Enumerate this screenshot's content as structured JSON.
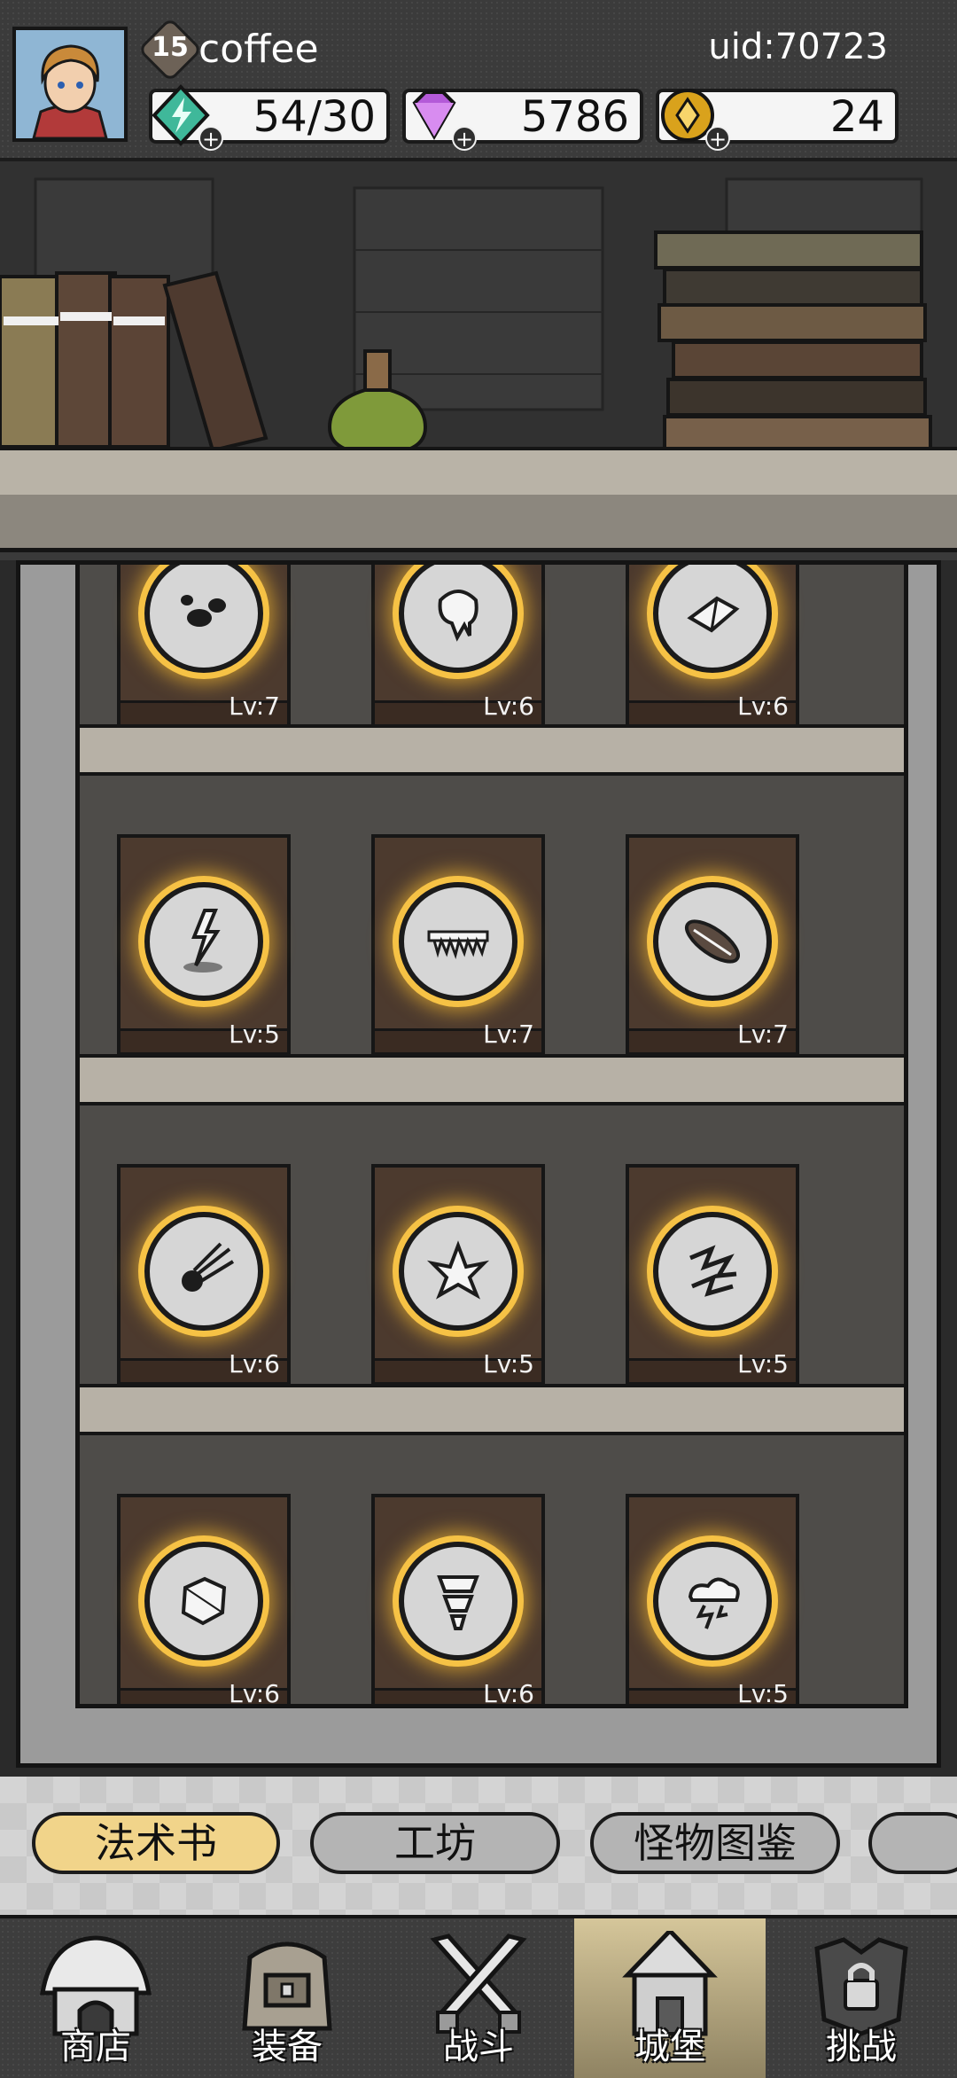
{
  "player": {
    "level": "15",
    "name": "coffee",
    "uid": "uid:70723"
  },
  "resources": [
    {
      "icon": "energy-lightning-gem-icon",
      "value": "54/30",
      "color": "#3fb89a"
    },
    {
      "icon": "purple-diamond-icon",
      "value": "5786",
      "color": "#b45ad8"
    },
    {
      "icon": "gold-coin-icon",
      "value": "24",
      "color": "#d9a21c"
    }
  ],
  "spellbooks": [
    {
      "icon": "dark-splash-icon",
      "level": "Lv:7"
    },
    {
      "icon": "slime-drip-icon",
      "level": "Lv:6"
    },
    {
      "icon": "crystal-shard-icon",
      "level": "Lv:6"
    },
    {
      "icon": "lightning-strike-icon",
      "level": "Lv:5"
    },
    {
      "icon": "ice-spikes-icon",
      "level": "Lv:7"
    },
    {
      "icon": "meteor-log-icon",
      "level": "Lv:7"
    },
    {
      "icon": "comet-icon",
      "level": "Lv:6"
    },
    {
      "icon": "ice-crystal-burst-icon",
      "level": "Lv:5"
    },
    {
      "icon": "chain-lightning-icon",
      "level": "Lv:5"
    },
    {
      "icon": "rock-shield-icon",
      "level": "Lv:6"
    },
    {
      "icon": "tornado-icon",
      "level": "Lv:6"
    },
    {
      "icon": "thunder-cloud-icon",
      "level": "Lv:5"
    }
  ],
  "tabs": [
    {
      "label": "法术书",
      "active": true
    },
    {
      "label": "工坊",
      "active": false
    },
    {
      "label": "怪物图鉴",
      "active": false
    },
    {
      "label": "",
      "active": false
    }
  ],
  "nav": [
    {
      "label": "商店",
      "icon": "shop-hut-icon",
      "active": false
    },
    {
      "label": "装备",
      "icon": "backpack-icon",
      "active": false
    },
    {
      "label": "战斗",
      "icon": "crossed-swords-icon",
      "active": false
    },
    {
      "label": "城堡",
      "icon": "castle-tower-icon",
      "active": true
    },
    {
      "label": "挑战",
      "icon": "locked-armor-icon",
      "active": false
    }
  ]
}
